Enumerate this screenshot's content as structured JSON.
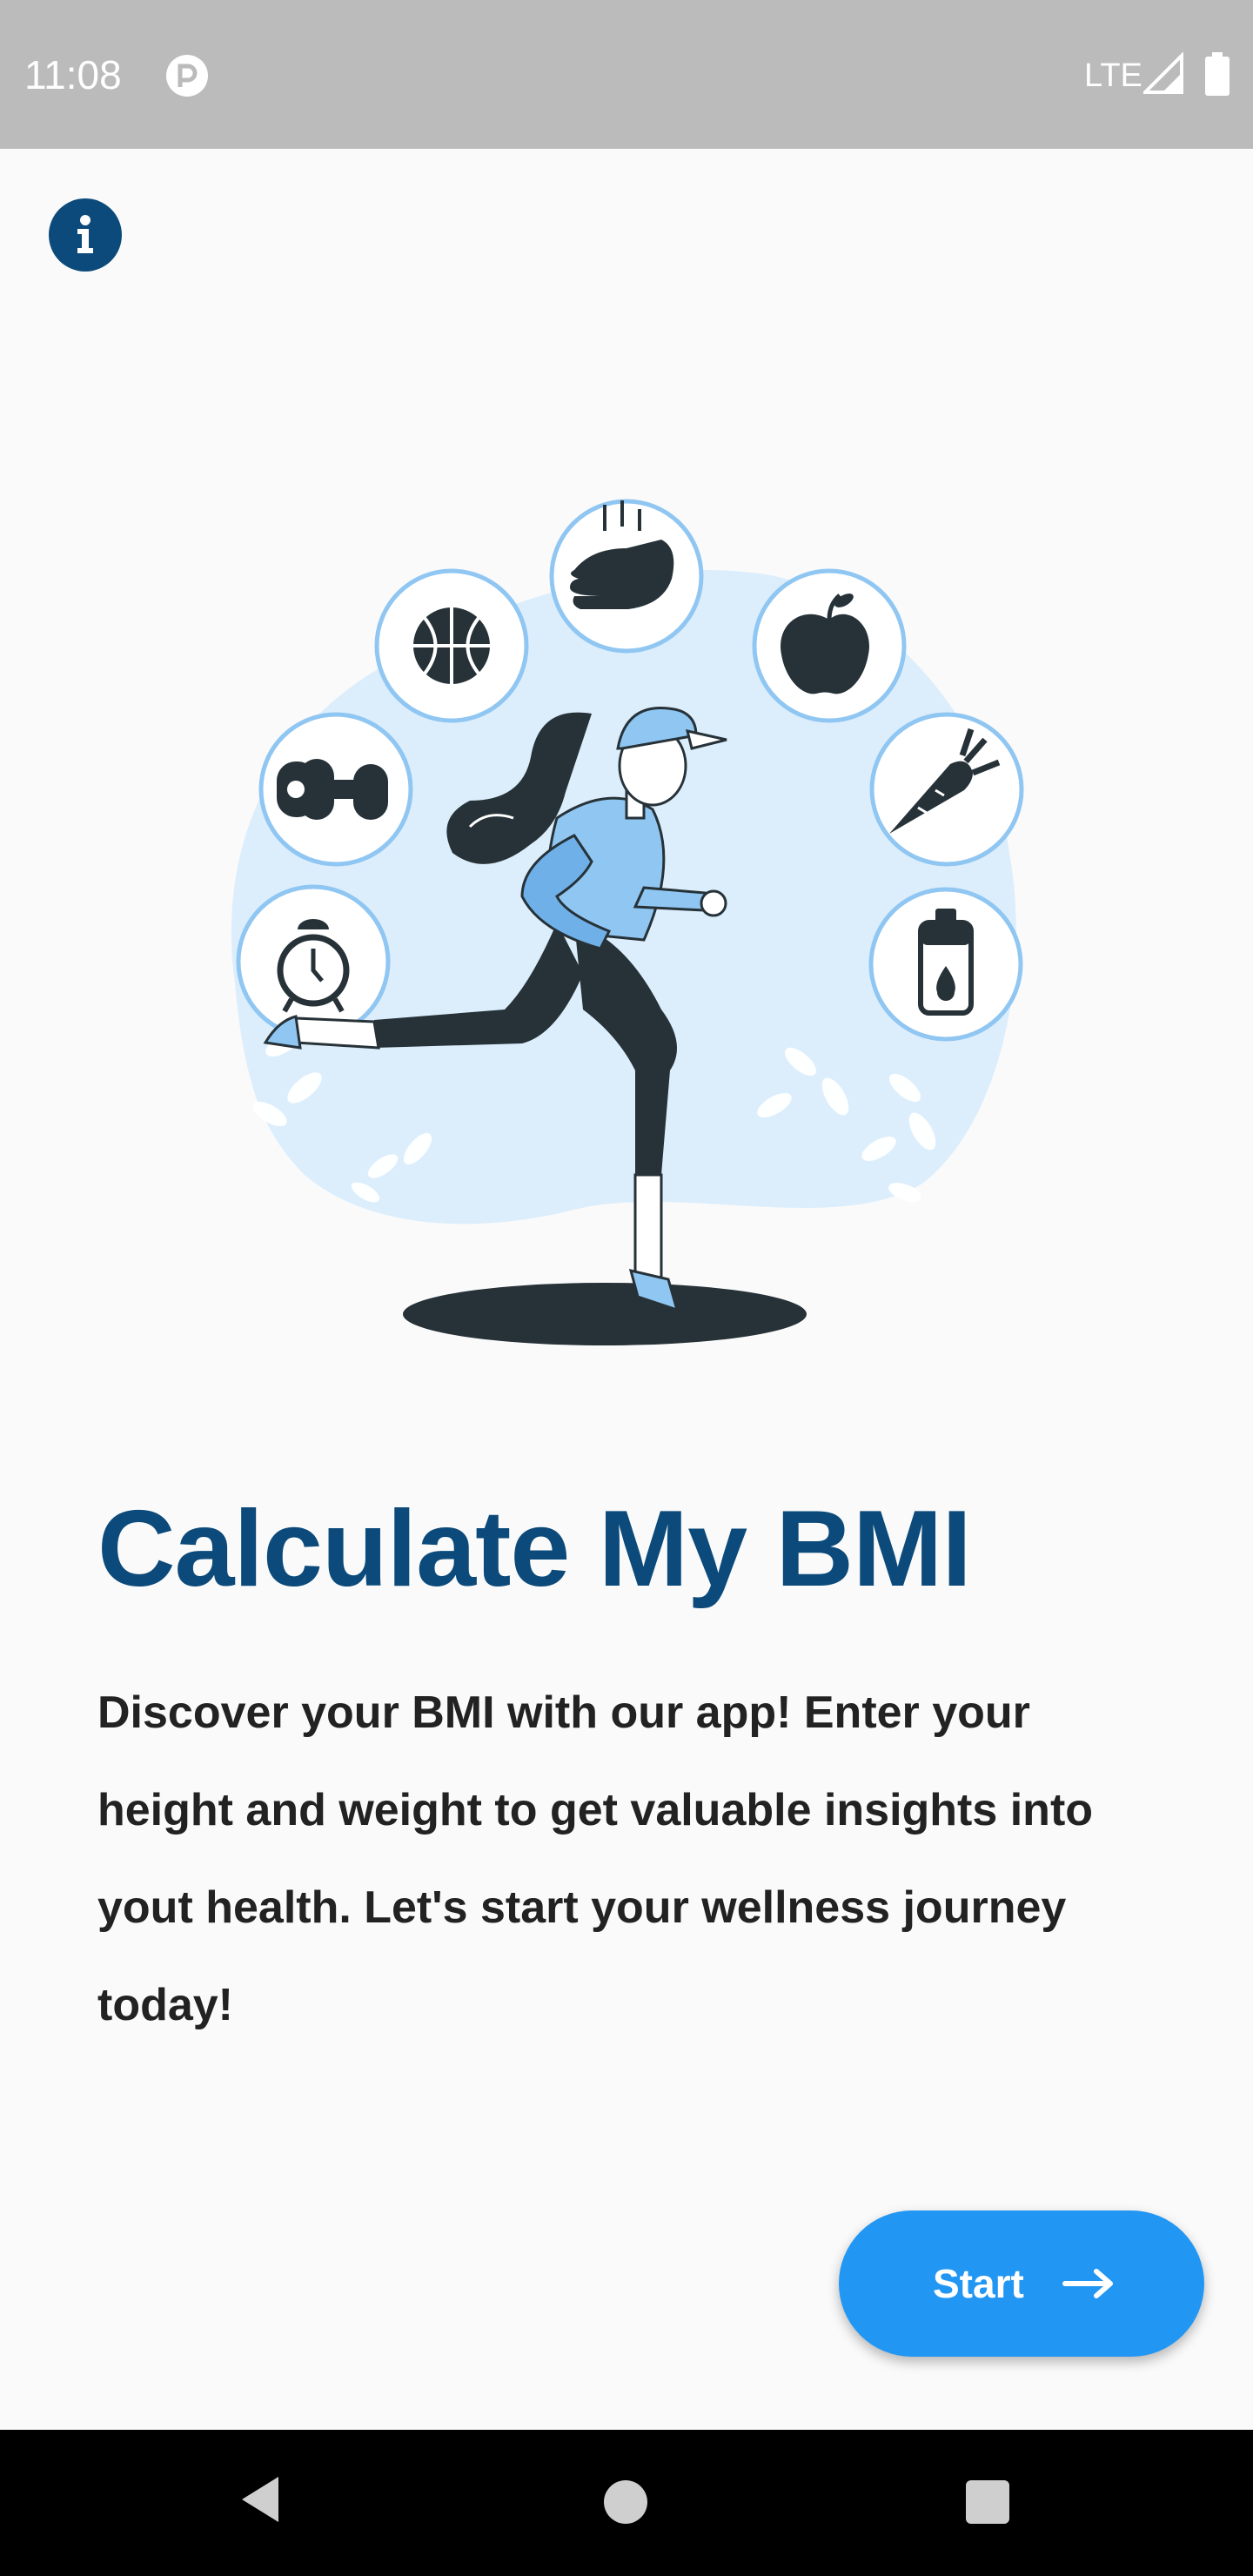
{
  "status_bar": {
    "time": "11:08",
    "network": "LTE",
    "icons": [
      "app-notification-icon",
      "signal-icon",
      "battery-icon"
    ]
  },
  "info_button": {
    "icon": "info-icon"
  },
  "illustration": {
    "icons": [
      "alarm-clock-icon",
      "dumbbell-icon",
      "basketball-icon",
      "hand-wash-icon",
      "apple-icon",
      "carrot-icon",
      "water-bottle-icon"
    ]
  },
  "title": "Calculate My BMI",
  "description": "Discover your BMI with our app! Enter your height and weight to get valuable insights into yout health. Let's start your wellness journey today!",
  "start_button": {
    "label": "Start",
    "icon": "arrow-right-icon"
  },
  "nav_bar": {
    "icons": [
      "back-icon",
      "home-icon",
      "recents-icon"
    ]
  },
  "colors": {
    "primary": "#0b4a7a",
    "accent": "#2196f3",
    "status_bar": "#bbbbbb",
    "illustration_light": "#dceefc",
    "illustration_mid": "#90c6f2",
    "illustration_dark": "#263238"
  }
}
